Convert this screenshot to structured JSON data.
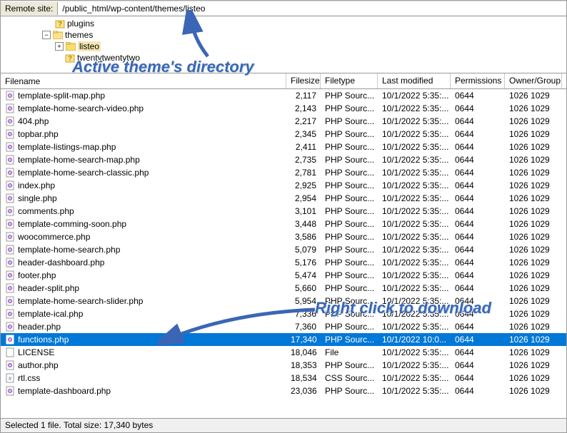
{
  "remote_label": "Remote site:",
  "remote_path": "/public_html/wp-content/themes/listeo",
  "tree": {
    "plugins": "plugins",
    "themes": "themes",
    "listeo": "listeo",
    "twentytwentytwo": "twentytwentytwo"
  },
  "columns": {
    "name": "Filename",
    "size": "Filesize",
    "type": "Filetype",
    "mod": "Last modified",
    "perm": "Permissions",
    "own": "Owner/Group"
  },
  "files": [
    {
      "icon": "php",
      "name": "template-split-map.php",
      "size": "2,117",
      "type": "PHP Sourc...",
      "mod": "10/1/2022 5:35:...",
      "perm": "0644",
      "own": "1026 1029"
    },
    {
      "icon": "php",
      "name": "template-home-search-video.php",
      "size": "2,143",
      "type": "PHP Sourc...",
      "mod": "10/1/2022 5:35:...",
      "perm": "0644",
      "own": "1026 1029"
    },
    {
      "icon": "php",
      "name": "404.php",
      "size": "2,217",
      "type": "PHP Sourc...",
      "mod": "10/1/2022 5:35:...",
      "perm": "0644",
      "own": "1026 1029"
    },
    {
      "icon": "php",
      "name": "topbar.php",
      "size": "2,345",
      "type": "PHP Sourc...",
      "mod": "10/1/2022 5:35:...",
      "perm": "0644",
      "own": "1026 1029"
    },
    {
      "icon": "php",
      "name": "template-listings-map.php",
      "size": "2,411",
      "type": "PHP Sourc...",
      "mod": "10/1/2022 5:35:...",
      "perm": "0644",
      "own": "1026 1029"
    },
    {
      "icon": "php",
      "name": "template-home-search-map.php",
      "size": "2,735",
      "type": "PHP Sourc...",
      "mod": "10/1/2022 5:35:...",
      "perm": "0644",
      "own": "1026 1029"
    },
    {
      "icon": "php",
      "name": "template-home-search-classic.php",
      "size": "2,781",
      "type": "PHP Sourc...",
      "mod": "10/1/2022 5:35:...",
      "perm": "0644",
      "own": "1026 1029"
    },
    {
      "icon": "php",
      "name": "index.php",
      "size": "2,925",
      "type": "PHP Sourc...",
      "mod": "10/1/2022 5:35:...",
      "perm": "0644",
      "own": "1026 1029"
    },
    {
      "icon": "php",
      "name": "single.php",
      "size": "2,954",
      "type": "PHP Sourc...",
      "mod": "10/1/2022 5:35:...",
      "perm": "0644",
      "own": "1026 1029"
    },
    {
      "icon": "php",
      "name": "comments.php",
      "size": "3,101",
      "type": "PHP Sourc...",
      "mod": "10/1/2022 5:35:...",
      "perm": "0644",
      "own": "1026 1029"
    },
    {
      "icon": "php",
      "name": "template-comming-soon.php",
      "size": "3,448",
      "type": "PHP Sourc...",
      "mod": "10/1/2022 5:35:...",
      "perm": "0644",
      "own": "1026 1029"
    },
    {
      "icon": "php",
      "name": "woocommerce.php",
      "size": "3,586",
      "type": "PHP Sourc...",
      "mod": "10/1/2022 5:35:...",
      "perm": "0644",
      "own": "1026 1029"
    },
    {
      "icon": "php",
      "name": "template-home-search.php",
      "size": "5,079",
      "type": "PHP Sourc...",
      "mod": "10/1/2022 5:35:...",
      "perm": "0644",
      "own": "1026 1029"
    },
    {
      "icon": "php",
      "name": "header-dashboard.php",
      "size": "5,176",
      "type": "PHP Sourc...",
      "mod": "10/1/2022 5:35:...",
      "perm": "0644",
      "own": "1026 1029"
    },
    {
      "icon": "php",
      "name": "footer.php",
      "size": "5,474",
      "type": "PHP Sourc...",
      "mod": "10/1/2022 5:35:...",
      "perm": "0644",
      "own": "1026 1029"
    },
    {
      "icon": "php",
      "name": "header-split.php",
      "size": "5,660",
      "type": "PHP Sourc...",
      "mod": "10/1/2022 5:35:...",
      "perm": "0644",
      "own": "1026 1029"
    },
    {
      "icon": "php",
      "name": "template-home-search-slider.php",
      "size": "5,954",
      "type": "PHP Sourc...",
      "mod": "10/1/2022 5:35:...",
      "perm": "0644",
      "own": "1026 1029"
    },
    {
      "icon": "php",
      "name": "template-ical.php",
      "size": "7,336",
      "type": "PHP Sourc...",
      "mod": "10/1/2022 5:35:...",
      "perm": "0644",
      "own": "1026 1029"
    },
    {
      "icon": "php",
      "name": "header.php",
      "size": "7,360",
      "type": "PHP Sourc...",
      "mod": "10/1/2022 5:35:...",
      "perm": "0644",
      "own": "1026 1029"
    },
    {
      "icon": "php",
      "name": "functions.php",
      "size": "17,340",
      "type": "PHP Sourc...",
      "mod": "10/1/2022 10:0...",
      "perm": "0644",
      "own": "1026 1029",
      "selected": true
    },
    {
      "icon": "file",
      "name": "LICENSE",
      "size": "18,046",
      "type": "File",
      "mod": "10/1/2022 5:35:...",
      "perm": "0644",
      "own": "1026 1029"
    },
    {
      "icon": "php",
      "name": "author.php",
      "size": "18,353",
      "type": "PHP Sourc...",
      "mod": "10/1/2022 5:35:...",
      "perm": "0644",
      "own": "1026 1029"
    },
    {
      "icon": "css",
      "name": "rtl.css",
      "size": "18,534",
      "type": "CSS Sourc...",
      "mod": "10/1/2022 5:35:...",
      "perm": "0644",
      "own": "1026 1029"
    },
    {
      "icon": "php",
      "name": "template-dashboard.php",
      "size": "23,036",
      "type": "PHP Sourc...",
      "mod": "10/1/2022 5:35:...",
      "perm": "0644",
      "own": "1026 1029"
    }
  ],
  "status": "Selected 1 file. Total size: 17,340 bytes",
  "annotations": {
    "top": "Active theme's directory",
    "mid": "Right click to download"
  }
}
